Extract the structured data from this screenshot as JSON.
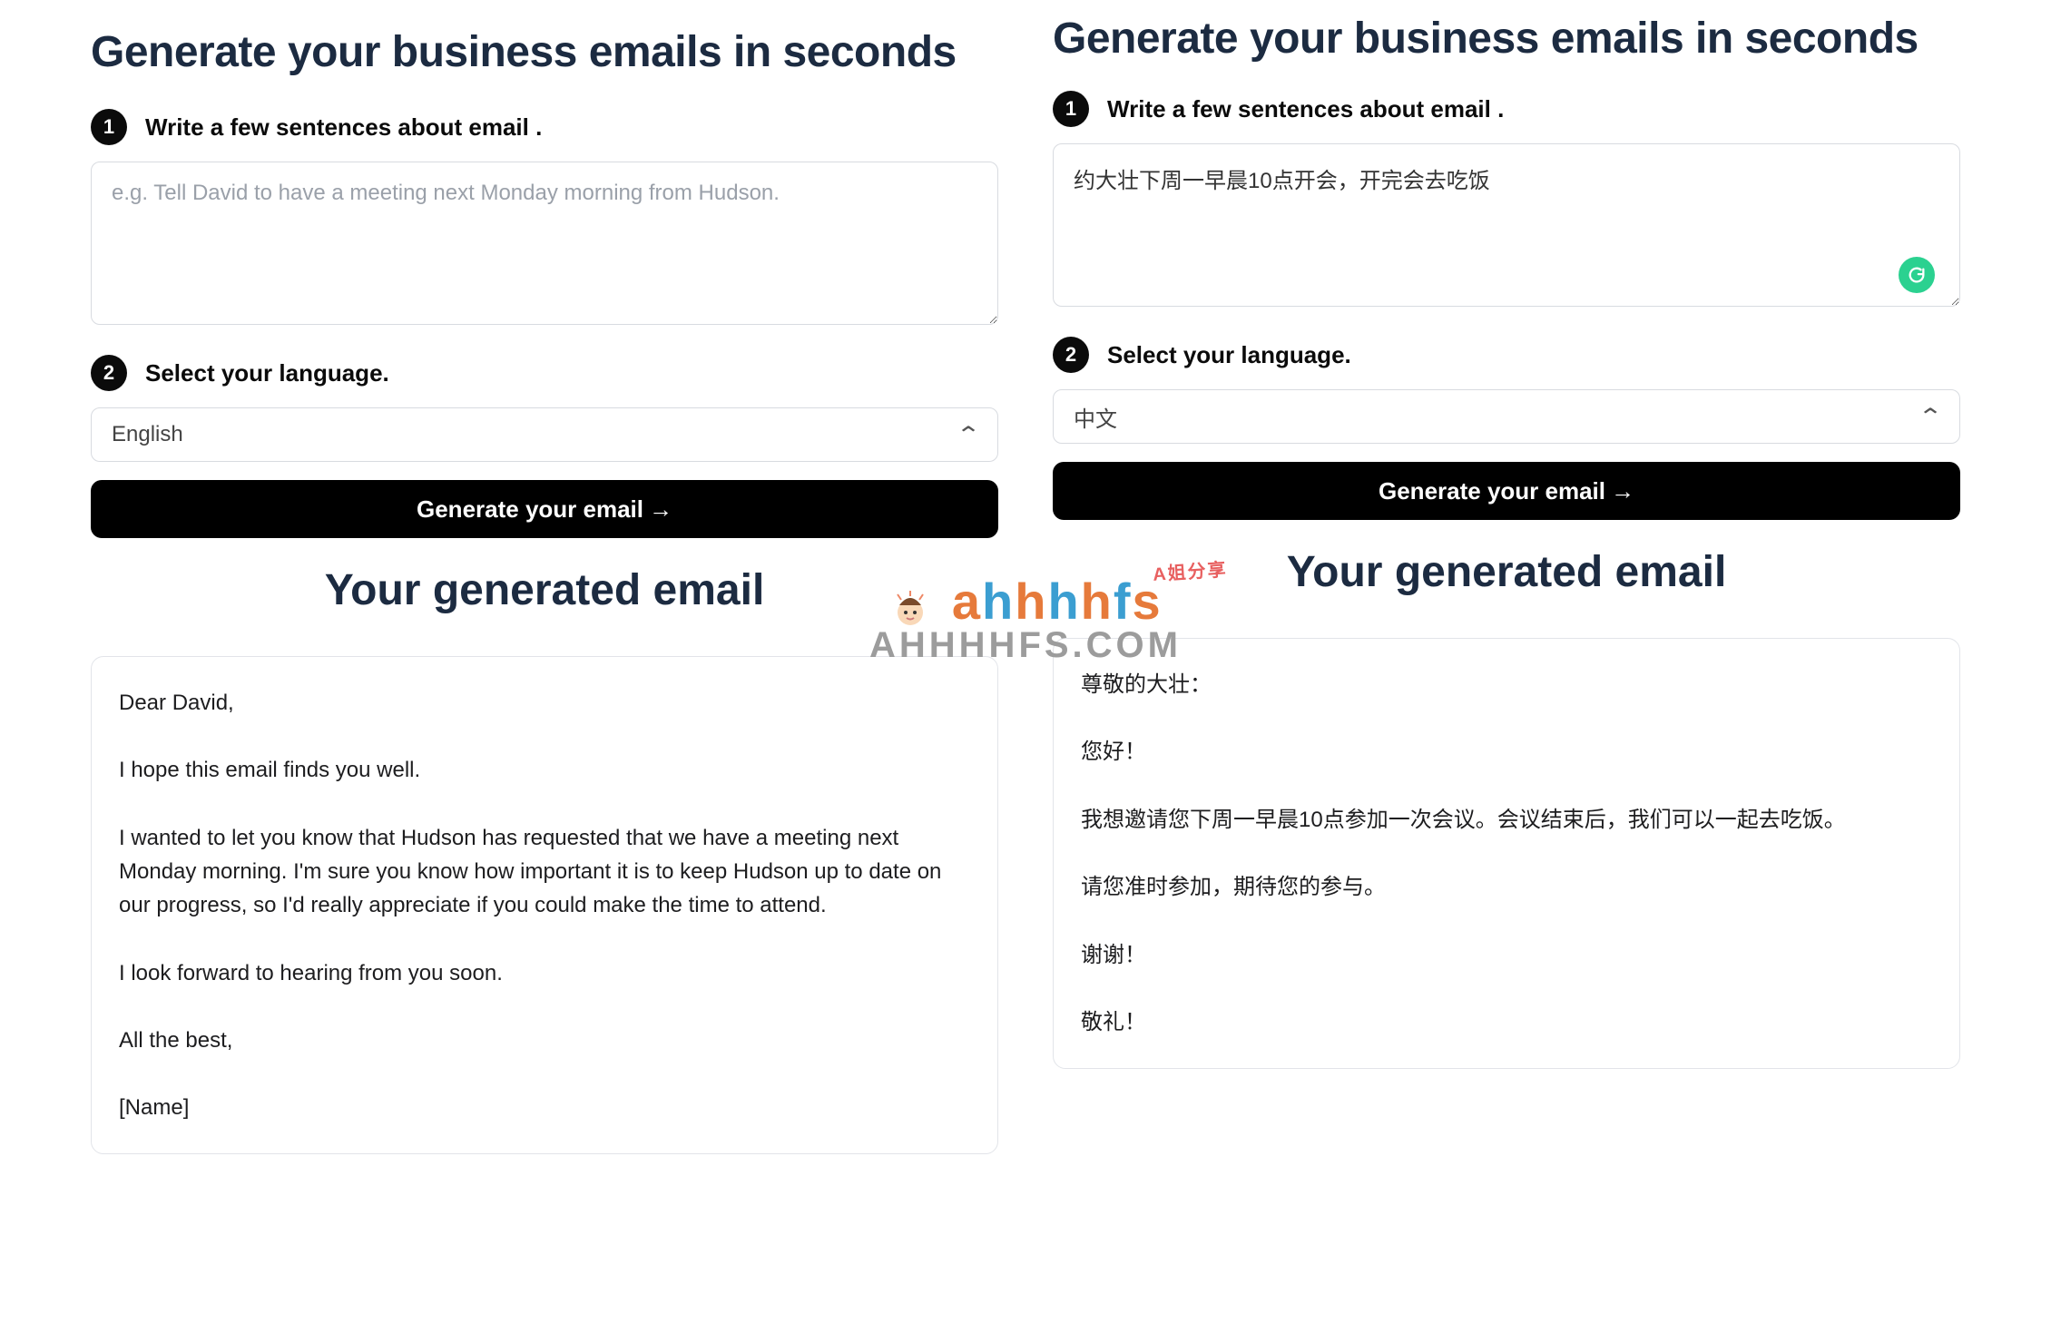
{
  "left": {
    "title": "Generate your business emails in seconds",
    "step1": {
      "num": "1",
      "label": "Write a few sentences about email ."
    },
    "textarea_placeholder": "e.g. Tell David to have a meeting next Monday morning from Hudson.",
    "textarea_value": "",
    "step2": {
      "num": "2",
      "label": "Select your language."
    },
    "language": "English",
    "generate_btn": "Generate your email",
    "result_title": "Your generated email",
    "email_body": "Dear David,\n\nI hope this email finds you well.\n\nI wanted to let you know that Hudson has requested that we have a meeting next Monday morning. I'm sure you know how important it is to keep Hudson up to date on our progress, so I'd really appreciate if you could make the time to attend.\n\nI look forward to hearing from you soon.\n\nAll the best,\n\n[Name]"
  },
  "right": {
    "title": "Generate your business emails in seconds",
    "step1": {
      "num": "1",
      "label": "Write a few sentences about email ."
    },
    "textarea_placeholder": "",
    "textarea_value": "约大壮下周一早晨10点开会，开完会去吃饭",
    "step2": {
      "num": "2",
      "label": "Select your language."
    },
    "language": "中文",
    "generate_btn": "Generate your email",
    "result_title": "Your generated email",
    "email_body": "尊敬的大壮：\n\n您好！\n\n我想邀请您下周一早晨10点参加一次会议。会议结束后，我们可以一起去吃饭。\n\n请您准时参加，期待您的参与。\n\n谢谢！\n\n敬礼！"
  },
  "watermark": {
    "brand": "ahhhhfs",
    "subtitle": "AHHHHFS.COM",
    "tag": "A姐分享"
  },
  "arrow_glyph": "→",
  "chevron_glyph": "⌃"
}
